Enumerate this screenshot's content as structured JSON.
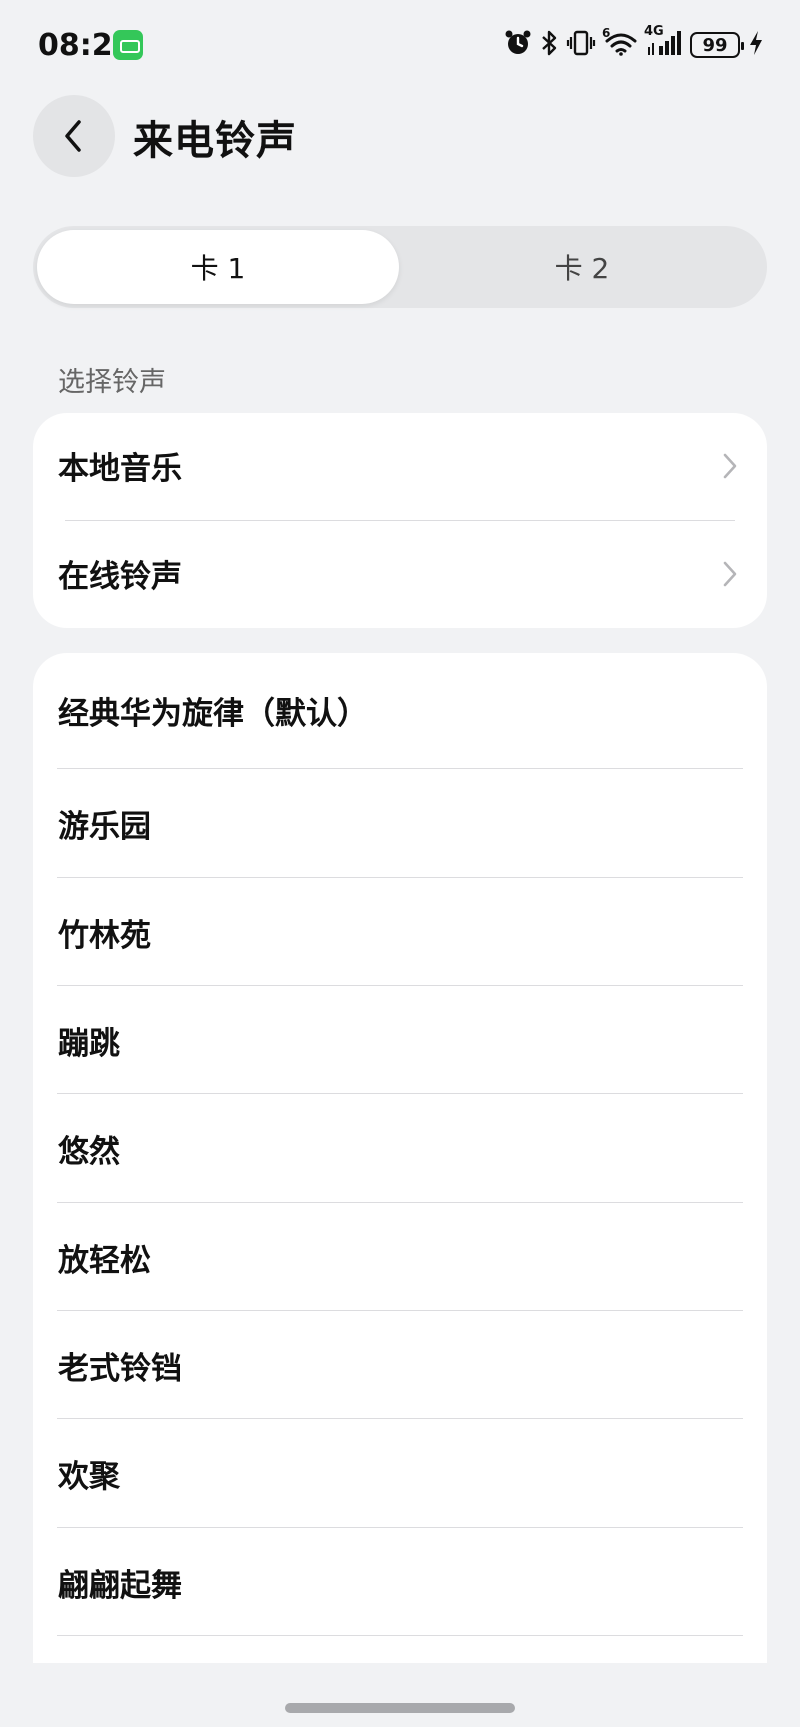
{
  "status_bar": {
    "time": "08:22",
    "network": "4G",
    "wifi_label": "6",
    "battery": "99"
  },
  "header": {
    "title": "来电铃声"
  },
  "sim_tabs": {
    "tabs": [
      {
        "label": "卡 1",
        "selected": true
      },
      {
        "label": "卡 2",
        "selected": false
      }
    ]
  },
  "section": {
    "label": "选择铃声"
  },
  "sources": {
    "items": [
      {
        "label": "本地音乐"
      },
      {
        "label": "在线铃声"
      }
    ]
  },
  "ringtones": {
    "items": [
      {
        "label": "经典华为旋律（默认）"
      },
      {
        "label": "游乐园"
      },
      {
        "label": "竹林苑"
      },
      {
        "label": "蹦跳"
      },
      {
        "label": "悠然"
      },
      {
        "label": "放轻松"
      },
      {
        "label": "老式铃铛"
      },
      {
        "label": "欢聚"
      },
      {
        "label": "翩翩起舞"
      }
    ]
  },
  "colors": {
    "background": "#f1f2f4",
    "card": "#ffffff",
    "badge_green": "#34c759",
    "text_primary": "#111111",
    "text_secondary": "#666666"
  }
}
